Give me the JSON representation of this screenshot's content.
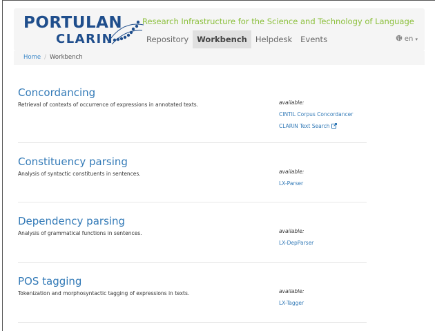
{
  "brand": {
    "name_top": "PORTULAN",
    "name_bottom": "CLARIN",
    "tagline": "Research Infrastructure for the Science and Technology of Language",
    "primary_color": "#1f4e8c",
    "tagline_color": "#8bbf3b",
    "link_color": "#337ab7"
  },
  "nav": {
    "items": [
      {
        "label": "Repository",
        "active": false
      },
      {
        "label": "Workbench",
        "active": true
      },
      {
        "label": "Helpdesk",
        "active": false
      },
      {
        "label": "Events",
        "active": false
      }
    ],
    "language": {
      "icon": "globe-icon",
      "label": "en"
    }
  },
  "breadcrumb": {
    "home": "Home",
    "separator": "/",
    "current": "Workbench"
  },
  "sections": [
    {
      "title": "Concordancing",
      "description": "Retrieval of contexts of occurrence of expressions in annotated texts.",
      "available_label": "available:",
      "tools": [
        {
          "label": "CINTIL Corpus Concordancer",
          "external": false
        },
        {
          "label": "CLARIN Text Search",
          "external": true
        }
      ]
    },
    {
      "title": "Constituency parsing",
      "description": "Analysis of syntactic constituents in sentences.",
      "available_label": "available:",
      "tools": [
        {
          "label": "LX-Parser",
          "external": false
        }
      ]
    },
    {
      "title": "Dependency parsing",
      "description": "Analysis of grammatical functions in sentences.",
      "available_label": "available:",
      "tools": [
        {
          "label": "LX-DepParser",
          "external": false
        }
      ]
    },
    {
      "title": "POS tagging",
      "description": "Tokenization and morphosyntactic tagging of expressions in texts.",
      "available_label": "available:",
      "tools": [
        {
          "label": "LX-Tagger",
          "external": false
        }
      ]
    }
  ]
}
